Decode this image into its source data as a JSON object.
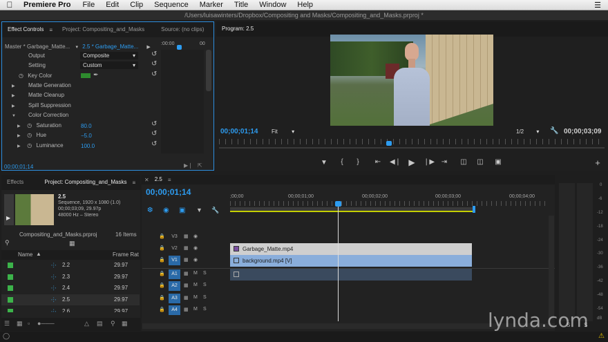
{
  "menubar": {
    "app_name": "Premiere Pro",
    "items": [
      "File",
      "Edit",
      "Clip",
      "Sequence",
      "Marker",
      "Title",
      "Window",
      "Help"
    ],
    "right_icon": "list-icon"
  },
  "window_title": "/Users/luisawinters/Dropbox/Compositing and Masks/Compositing_and_Masks.prproj *",
  "effect_controls": {
    "tabs": [
      "Effect Controls",
      "Project: Compositing_and_Masks",
      "Source: (no clips)"
    ],
    "master": "Master * Garbage_Matte...",
    "clip": "2.5 * Garbage_Matte...",
    "ruler_start": ":00:00",
    "ruler_end": "00",
    "params": {
      "output_label": "Output",
      "output_value": "Composite",
      "setting_label": "Setting",
      "setting_value": "Custom",
      "key_color_label": "Key Color",
      "key_color": "#2e8b2e",
      "matte_generation": "Matte Generation",
      "matte_cleanup": "Matte Cleanup",
      "spill_suppression": "Spill Suppression",
      "color_correction": "Color Correction",
      "saturation_label": "Saturation",
      "saturation_value": "80.0",
      "hue_label": "Hue",
      "hue_value": "−5.0",
      "luminance_label": "Luminance",
      "luminance_value": "100.0"
    },
    "timecode": "00;00;01;14"
  },
  "program_monitor": {
    "title": "Program: 2.5",
    "timecode": "00;00;01;14",
    "fit": "Fit",
    "resolution": "1/2",
    "duration": "00;00;03;09"
  },
  "project_panel": {
    "tabs": [
      "Effects",
      "Project: Compositing_and_Masks"
    ],
    "seq_name": "2.5",
    "seq_info1": "Sequence, 1920 x 1080 (1.0)",
    "seq_info2": "00;00;03;09, 29.97p",
    "seq_info3": "48000 Hz – Stereo",
    "project_file": "Compositing_and_Masks.prproj",
    "item_count": "16 Items",
    "col_name": "Name",
    "col_frame": "Frame Rat",
    "items": [
      {
        "name": "2.2",
        "rate": "29.97"
      },
      {
        "name": "2.3",
        "rate": "29.97"
      },
      {
        "name": "2.4",
        "rate": "29.97"
      },
      {
        "name": "2.5",
        "rate": "29.97"
      },
      {
        "name": "2.6",
        "rate": "29.97"
      }
    ]
  },
  "timeline": {
    "tab": "2.5",
    "timecode": "00;00;01;14",
    "ruler": [
      ";00;00",
      "00;00;01;00",
      "00;00;02;00",
      "00;00;03;00",
      "00;00;04;00"
    ],
    "tracks_video": [
      "V3",
      "V2",
      "V1"
    ],
    "tracks_audio": [
      "A1",
      "A2",
      "A3",
      "A4"
    ],
    "clip_v2": "Garbage_Matte.mp4",
    "clip_v1": "background.mp4 [V]"
  },
  "audio_meter": {
    "labels": [
      "0",
      "-6",
      "-12",
      "-18",
      "-24",
      "-30",
      "-36",
      "-42",
      "-48",
      "-54",
      "dB"
    ],
    "s_label": "S"
  },
  "watermark": "lynda.com"
}
